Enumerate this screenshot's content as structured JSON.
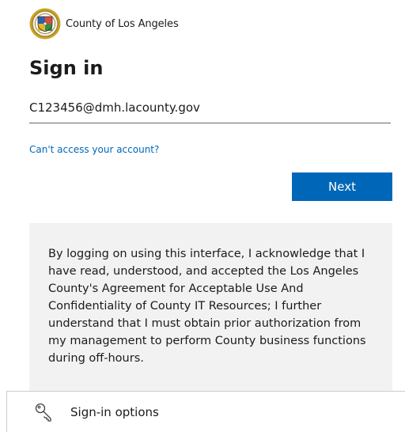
{
  "header": {
    "org_name": "County of Los Angeles",
    "logo_icon": "county-seal-icon"
  },
  "signin": {
    "title": "Sign in",
    "email_value": "C123456@dmh.lacounty.gov",
    "cant_access_link": "Can't access your account?",
    "next_label": "Next"
  },
  "notice": {
    "text": "By logging on using this interface, I acknowledge that I have read, understood, and accepted the Los Angeles County's Agreement for Acceptable Use And Confidentiality of County IT Resources; I further understand that I must obtain prior authorization from my management to perform County business functions during off-hours."
  },
  "footer": {
    "signin_options_label": "Sign-in options",
    "signin_options_icon": "key-icon"
  },
  "colors": {
    "accent": "#0067b8",
    "notice_bg": "#f2f2f2",
    "text": "#1b1b1b"
  }
}
